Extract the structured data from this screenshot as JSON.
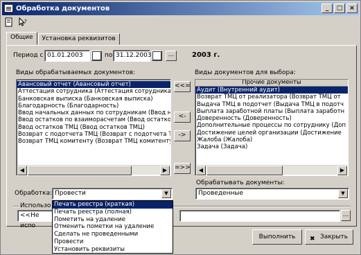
{
  "window": {
    "title": "Обработка документов",
    "controls": [
      "_",
      "□",
      "×"
    ]
  },
  "toolbar": {
    "icons": [
      "document-icon",
      "help-cursor-icon"
    ]
  },
  "tabs": [
    {
      "label": "Общие"
    },
    {
      "label": "Установка реквизитов"
    }
  ],
  "period": {
    "label_from": "Период с",
    "date_from": "01.01.2003",
    "label_to": "по",
    "date_to": "31.12.2003",
    "ellipsis": "...",
    "year_text": "2003 г."
  },
  "left_list": {
    "label": "Виды обрабатываемых документов:",
    "items": [
      "Авансовый отчет (Авансовый отчет)",
      "Аттестация сотрудника (Аттестация сотрудника)",
      "Банковская выписка (Банковская выписка)",
      "Благодарность (Благодарность)",
      "Ввод начальных данных по сотрудникам (Ввод нач",
      "Ввод остатков по взаиморасчетам (Ввод остатков",
      "Ввод остатков ТМЦ (Ввод остатков ТМЦ)",
      "Возврат с подотчета ТМЦ (Возврат с подотчета ТМ",
      "Возврат ТМЦ комитенту (Возврат ТМЦ комитенту)"
    ]
  },
  "move_buttons": [
    "<<=",
    "<-",
    "->",
    "=>>"
  ],
  "right_list": {
    "label": "Виды документов для выбора:",
    "column_header": "Прочие документы",
    "items": [
      "Аудит (Внутренний аудит)",
      "Возврат ТМЦ от реализатора (Возврат ТМЦ от",
      "Выдача ТМЦ в подотчет (Выдача ТМЦ в подотч",
      "Выплата заработной платы (Выплата заработн",
      "Доверенность (Доверенность)",
      "Дополнительные процессы по сотруднику (Доп",
      "Достижение целей организации (Достижение",
      "Жалоба (Жалоба)",
      "Задача (Задача)"
    ]
  },
  "processing": {
    "label": "Обработка:",
    "value": "Провести",
    "options": [
      "Печать реестра (краткая)",
      "Печать реестра (полная)",
      "Пометить на удаление",
      "Отменить пометки на удаление",
      "Сделать не проведенными",
      "Провести",
      "Установить реквизиты"
    ]
  },
  "process_docs": {
    "label": "Обрабатывать документы:",
    "value": "Проведенные"
  },
  "use_section": {
    "label": "Использо",
    "field_value": "<<Не испо"
  },
  "buttons": {
    "run": "Выполнить",
    "close": "Закрыть"
  }
}
